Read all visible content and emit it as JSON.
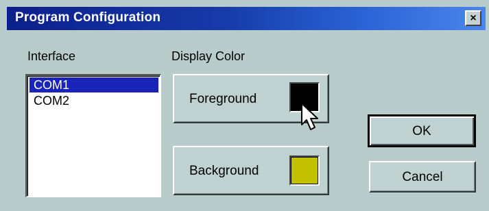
{
  "window": {
    "title": "Program Configuration",
    "close_glyph": "×"
  },
  "interface": {
    "label": "Interface",
    "items": [
      {
        "label": "COM1",
        "selected": true
      },
      {
        "label": "COM2",
        "selected": false
      }
    ]
  },
  "display_color": {
    "label": "Display Color",
    "foreground": {
      "label": "Foreground",
      "color": "#000000"
    },
    "background": {
      "label": "Background",
      "color": "#c3c000"
    }
  },
  "buttons": {
    "ok": "OK",
    "cancel": "Cancel"
  },
  "cursor": {
    "icon": "arrow-pointer-icon"
  }
}
